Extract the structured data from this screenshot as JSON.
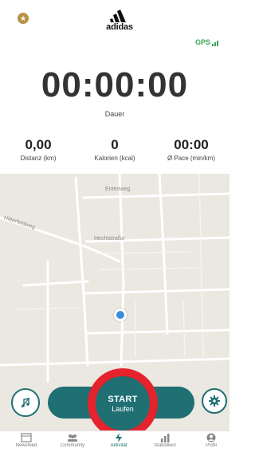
{
  "header": {
    "brand": "adidas",
    "gps_label": "GPS",
    "star_icon": "star-icon"
  },
  "timer": {
    "value": "00:00:00",
    "label": "Dauer"
  },
  "stats": [
    {
      "value": "0,00",
      "label": "Distanz (km)"
    },
    {
      "value": "0",
      "label": "Kalorien (kcal)"
    },
    {
      "value": "00:00",
      "label": "Ø Pace (min/km)"
    }
  ],
  "map": {
    "streets": [
      "Entenweg",
      "Hechtstraße",
      "Hitterfeldweg"
    ]
  },
  "controls": {
    "start_label": "START",
    "start_sub": "Laufen",
    "music_icon": "music-off-icon",
    "settings_icon": "gear-icon"
  },
  "nav": {
    "items": [
      {
        "label": "Newsfeed",
        "icon": "newsfeed-icon"
      },
      {
        "label": "Community",
        "icon": "community-icon"
      },
      {
        "label": "Aktivität",
        "icon": "activity-icon"
      },
      {
        "label": "Statistiken",
        "icon": "statistics-icon"
      },
      {
        "label": "Profil",
        "icon": "profile-icon"
      }
    ]
  },
  "colors": {
    "primary": "#1f6f73",
    "highlight_ring": "#e5232c",
    "gps": "#3aa655",
    "gold": "#b99248",
    "location": "#3b8fd9"
  }
}
